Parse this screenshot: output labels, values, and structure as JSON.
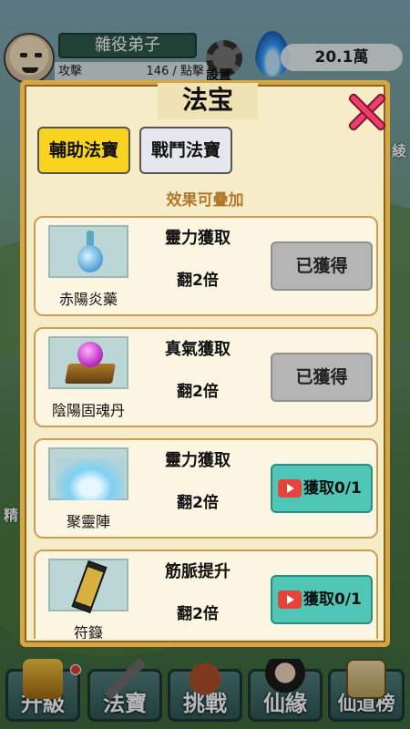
{
  "player": {
    "name": "雜役弟子",
    "stat_left": "攻擊",
    "stat_right": "146 / 點擊",
    "settings_label": "設置",
    "currency": "20.1萬"
  },
  "side_stubs": {
    "left": "精",
    "right": "綾"
  },
  "modal": {
    "title": "法宝",
    "tabs": [
      {
        "label": "輔助法寶",
        "active": true
      },
      {
        "label": "戰鬥法寶",
        "active": false
      }
    ],
    "note": "效果可疊加",
    "items": [
      {
        "name": "赤陽炎藥",
        "effect": "靈力獲取",
        "multiplier": "翻2倍",
        "button": "已獲得",
        "owned": true,
        "icon": "potion-icon"
      },
      {
        "name": "陰陽固魂丹",
        "effect": "真氣獲取",
        "multiplier": "翻2倍",
        "button": "已獲得",
        "owned": true,
        "icon": "orb-icon"
      },
      {
        "name": "聚靈陣",
        "effect": "靈力獲取",
        "multiplier": "翻2倍",
        "button": "獲取0/1",
        "owned": false,
        "icon": "aura-icon"
      },
      {
        "name": "符籙",
        "effect": "筋脈提升",
        "multiplier": "翻2倍",
        "button": "獲取0/1",
        "owned": false,
        "icon": "talisman-icon"
      }
    ]
  },
  "bottom_nav": [
    {
      "label": "升級",
      "icon": "level-up-icon",
      "badge": true
    },
    {
      "label": "法寶",
      "icon": "sword-icon",
      "badge": false
    },
    {
      "label": "挑戰",
      "icon": "crossed-swords-icon",
      "badge": false
    },
    {
      "label": "仙緣",
      "icon": "maiden-icon",
      "badge": false
    },
    {
      "label": "仙道榜",
      "icon": "scroll-icon",
      "badge": false
    }
  ],
  "colors": {
    "modal_bg": "#f6ecc8",
    "modal_border": "#d7a640",
    "tab_active": "#f9d31e",
    "button_owned": "#b5b5b5",
    "button_get": "#4fc6b6",
    "close": "#ee3f6a",
    "note": "#b0782f"
  }
}
